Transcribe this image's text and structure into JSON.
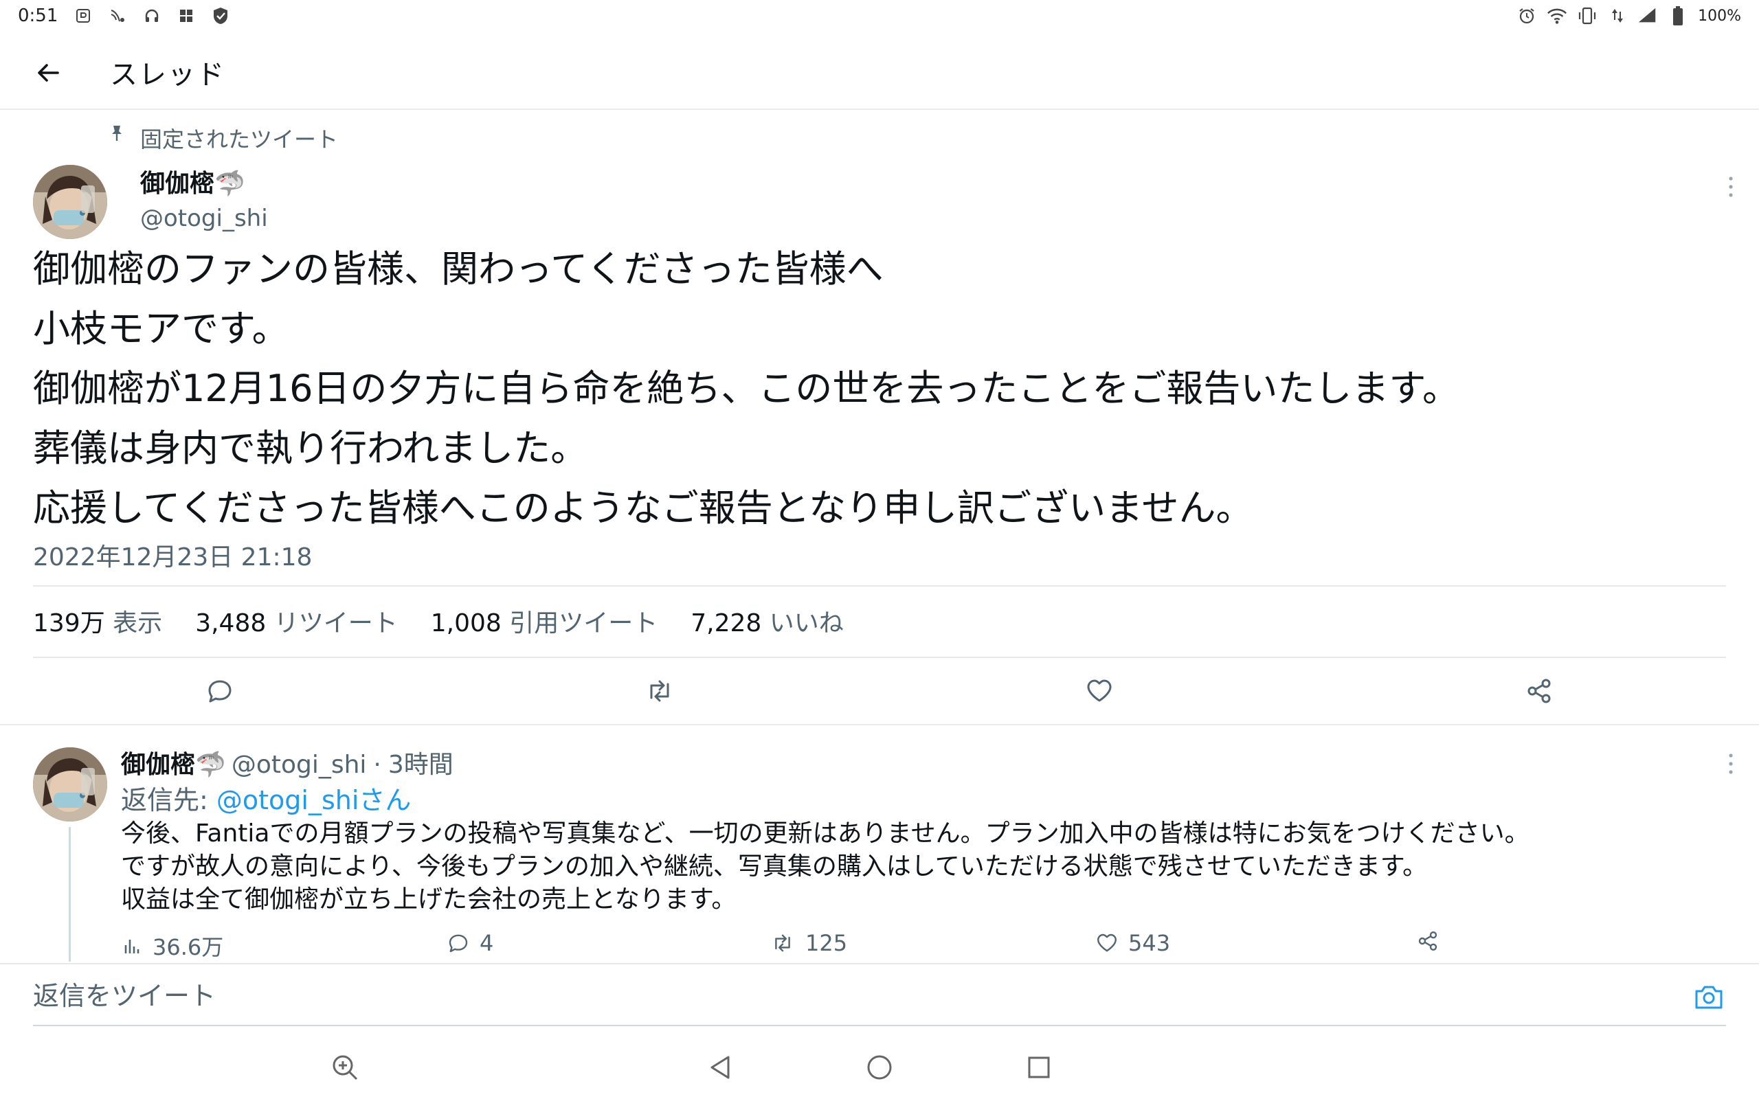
{
  "status_bar": {
    "time": "0:51",
    "battery_text": "100%",
    "left_icons": [
      "app-notification-icon",
      "nfc-icon",
      "headphones-icon",
      "grid-app-icon",
      "shield-icon"
    ],
    "right_icons": [
      "alarm-icon",
      "wifi-icon",
      "vibrate-icon",
      "data-arrows-icon",
      "signal-icon",
      "battery-icon"
    ]
  },
  "header": {
    "title": "スレッド"
  },
  "pinned_tweet": {
    "pinned_label": "固定されたツイート",
    "author_name": "御伽樒🦈",
    "author_handle": "@otogi_shi",
    "lines": [
      "御伽樒のファンの皆様、関わってくださった皆様へ",
      "小枝モアです。",
      "御伽樒が12月16日の夕方に自ら命を絶ち、この世を去ったことをご報告いたします。",
      "葬儀は身内で執り行われました。",
      "応援してくださった皆様へこのようなご報告となり申し訳ございません。"
    ],
    "timestamp": "2022年12月23日 21:18",
    "stats": [
      {
        "num": "139万",
        "label": "表示"
      },
      {
        "num": "3,488",
        "label": "リツイート"
      },
      {
        "num": "1,008",
        "label": "引用ツイート"
      },
      {
        "num": "7,228",
        "label": "いいね"
      }
    ]
  },
  "reply_tweet": {
    "author_name": "御伽樒🦈",
    "author_handle": "@otogi_shi",
    "separator": "·",
    "time_ago": "3時間",
    "reply_to_prefix": "返信先: ",
    "reply_to_handle": "@otogi_shi",
    "reply_to_suffix": "さん",
    "lines": [
      "今後、Fantiaでの月額プランの投稿や写真集など、一切の更新はありません。プラン加入中の皆様は特にお気をつけください。",
      "ですが故人の意向により、今後もプランの加入や継続、写真集の購入はしていただける状態で残させていただきます。",
      "収益は全て御伽樒が立ち上げた会社の売上となります。"
    ],
    "views": "36.6万",
    "replies": "4",
    "retweets": "125",
    "likes": "543"
  },
  "compose": {
    "placeholder": "返信をツイート"
  },
  "colors": {
    "accent": "#1d9bf0",
    "text": "#0f1419",
    "secondary": "#536471",
    "border": "#e7e9ea"
  }
}
